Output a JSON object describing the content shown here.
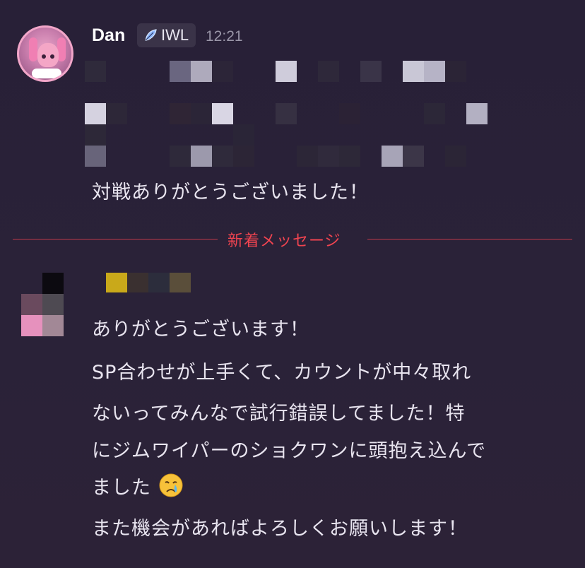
{
  "message1": {
    "username": "Dan",
    "badge_label": "IWL",
    "timestamp": "12:21",
    "text": "対戦ありがとうございました！"
  },
  "new_messages_divider": "新着メッセージ",
  "message2": {
    "lines": [
      "ありがとうございます！",
      "SP合わせが上手くて、カウントが中々取れ",
      "ないってみんなで試行錯誤してました！特",
      "にジムワイパーのショクワンに頭抱え込んで",
      "ました",
      "また機会があればよろしくお願いします！"
    ],
    "emoji": "crying-face"
  },
  "colors": {
    "background": "#2a2238",
    "divider": "#c0394a",
    "divider_text": "#f04450",
    "username": "#ffffff",
    "timestamp": "#9a96a8",
    "body_text": "#e8e4ef"
  }
}
